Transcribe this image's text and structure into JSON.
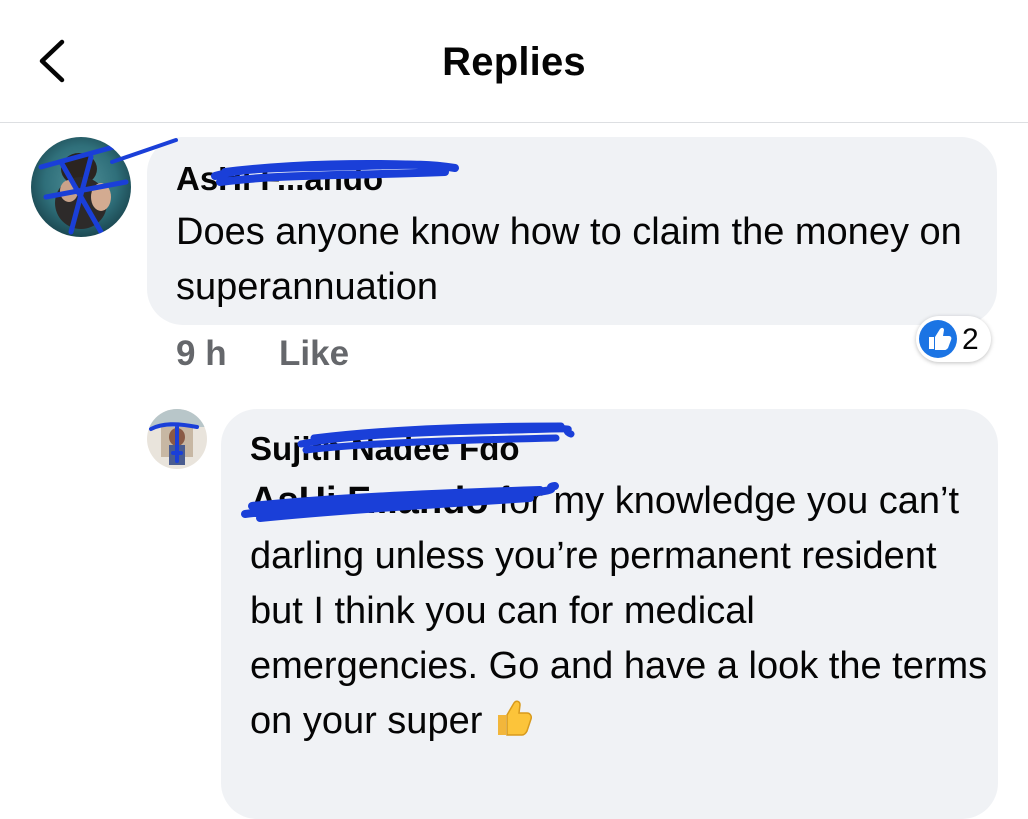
{
  "header": {
    "back_icon": "chevron-left-icon",
    "title": "Replies"
  },
  "comment": {
    "author": "AsHi F...ando",
    "text": "Does anyone know how to claim the money on superannuation",
    "time": "9 h",
    "like_label": "Like",
    "reaction_icon": "like-reaction-icon",
    "reaction_count": "2"
  },
  "reply": {
    "author": "Sujith Nadee Fdo",
    "mention": "AsHi F...ando",
    "text": "for my knowledge you can’t darling unless you’re permanent resident but I think you can for medical emergencies. Go and have a look the terms on your super",
    "emoji_icon": "thumbs-up-emoji-icon"
  },
  "colors": {
    "bubble": "#f0f2f5",
    "meta_text": "#65676b",
    "reaction_blue": "#1b74e4",
    "redaction_ink": "#1a3fd8"
  }
}
